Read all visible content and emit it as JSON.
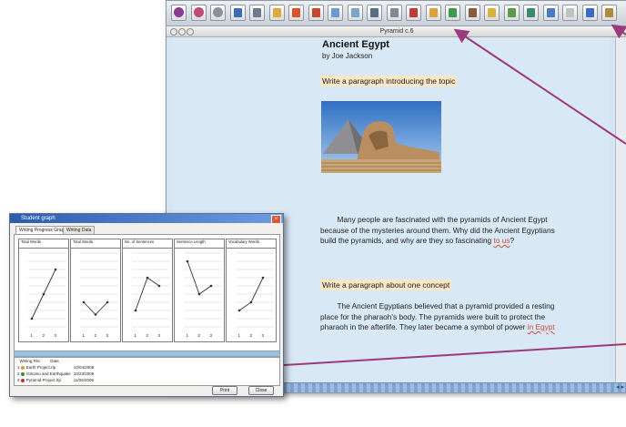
{
  "toolbar": {
    "icons": [
      "purple-circle-icon",
      "pink-circle-icon",
      "gray-circle-icon",
      "save-icon",
      "print-icon",
      "open-folder-icon",
      "list-icon",
      "list-icon",
      "picture-icon",
      "text-icon",
      "speaker-icon",
      "link-icon",
      "spellcheck-icon",
      "pencil-icon",
      "ruler-icon",
      "book-icon",
      "notes-icon",
      "graph-icon",
      "grid-icon",
      "web-icon",
      "text-size-icon",
      "font-icon",
      "paint-icon"
    ]
  },
  "window": {
    "title": "Pyramid c.6"
  },
  "document": {
    "title": "Ancient Egypt",
    "author": "by Joe Jackson",
    "prompt1": "Write a paragraph introducing the topic",
    "prompt2": "Write a paragraph about one concept",
    "para1": {
      "text": "Many people are fascinated with the pyramids of Ancient Egypt because of the mysteries around them. Why did the Ancient Egyptians build the pyramids, and why are they so fascinating ",
      "error": "to us",
      "end": "?"
    },
    "para2": {
      "text": "The Ancient Egyptians believed that a pyramid provided a resting place for the pharaoh's body.  The pyramids were built to protect the pharaoh in the afterlife.  They later became a symbol of power ",
      "error": "in Egypt"
    }
  },
  "dialog": {
    "title": "Student graph",
    "tabs": [
      "Writing Progress Graph",
      "Writing Data"
    ],
    "graphs": [
      {
        "title": "Total Words",
        "points": [
          1,
          4,
          7
        ]
      },
      {
        "title": "Total Words",
        "points": [
          3,
          1.5,
          3
        ]
      },
      {
        "title": "No. of Sentences",
        "points": [
          2,
          6,
          5
        ]
      },
      {
        "title": "Sentence Length",
        "points": [
          8,
          4,
          5
        ]
      },
      {
        "title": "Vocabulary Words",
        "points": [
          2,
          3,
          6
        ]
      }
    ],
    "axis_labels": [
      "1",
      "2",
      "3"
    ],
    "list_header": [
      "",
      "Writing File",
      "Date"
    ],
    "list_rows": [
      {
        "num": "1",
        "name": "Earth Project.rtp",
        "date": "10/04/2006",
        "color": "#d4a12f"
      },
      {
        "num": "2",
        "name": "Volcano and Earthquake",
        "date": "10/23/2006",
        "color": "#3b8a3c"
      },
      {
        "num": "3",
        "name": "Pyramid Project.rtp",
        "date": "11/06/2006",
        "color": "#c2322c"
      }
    ],
    "buttons": [
      "Print",
      "Close"
    ]
  },
  "colors": {
    "arrow": "#9b3b7d",
    "page": "#d8e8f5",
    "prompt_highlight": "#f8e7c4"
  }
}
